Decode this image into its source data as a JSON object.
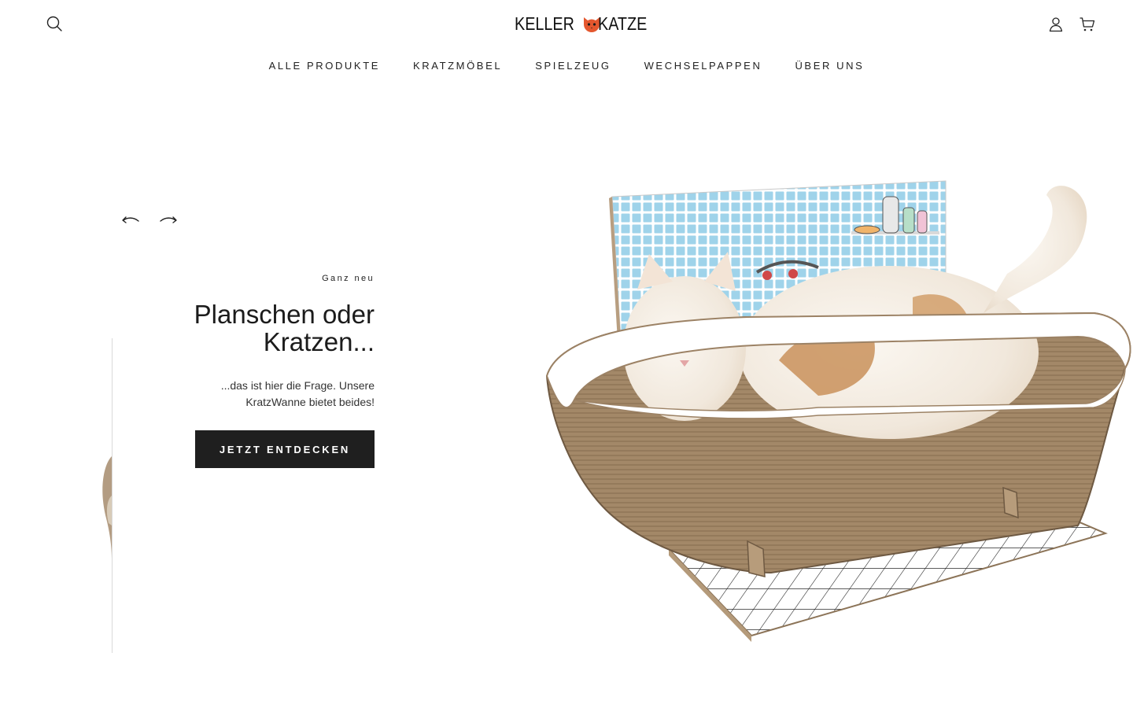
{
  "header": {
    "logo_left": "KELLER",
    "logo_right": "KATZE",
    "icons": {
      "search": "search-icon",
      "account": "user-icon",
      "cart": "shopping-cart-icon",
      "logo": "cat-face-icon"
    }
  },
  "nav": {
    "items": [
      {
        "label": "ALLE PRODUKTE"
      },
      {
        "label": "KRATZMÖBEL"
      },
      {
        "label": "SPIELZEUG"
      },
      {
        "label": "WECHSELPAPPEN"
      },
      {
        "label": "ÜBER UNS"
      }
    ]
  },
  "hero": {
    "eyebrow": "Ganz neu",
    "headline_line1": "Planschen oder",
    "headline_line2": "Kratzen...",
    "subline_line1": "...das ist hier die Frage. Unsere",
    "subline_line2": "KratzWanne bietet beides!",
    "cta_label": "JETZT ENTDECKEN",
    "controls": {
      "prev": "arrow-left-icon",
      "next": "arrow-right-icon"
    },
    "image": "cat-in-cardboard-bathtub"
  },
  "colors": {
    "text": "#1d1d1d",
    "button_bg": "#1f1f1f",
    "button_text": "#ffffff",
    "logo_accent": "#e4572e",
    "cardboard": "#9c8265",
    "tile_blue": "#9fd3ea"
  }
}
